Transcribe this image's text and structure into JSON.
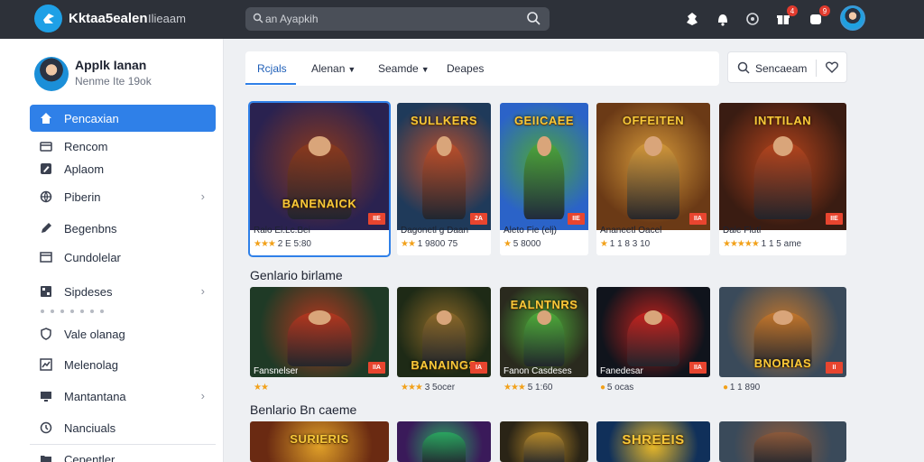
{
  "app": {
    "name": "Kktaa5ealen",
    "subtitle": "Ilieaam",
    "search_placeholder": "an Ayapkih",
    "brand_color": "#1ea0e6",
    "accent_color": "#2f80e8"
  },
  "topbar_icons": [
    {
      "icon": "puzzle-icon",
      "badge": ""
    },
    {
      "icon": "bell-icon",
      "badge": ""
    },
    {
      "icon": "circle-icon",
      "badge": ""
    },
    {
      "icon": "gift-icon",
      "badge": "4"
    },
    {
      "icon": "notification-icon",
      "badge": "9"
    }
  ],
  "profile": {
    "name": "Applk Ianan",
    "sub": "Nenme Ite 19ok"
  },
  "sidebar": {
    "items": [
      {
        "label": "Pencaxian",
        "icon": "home-icon",
        "chevron": false,
        "active": true
      },
      {
        "label": "Rencom",
        "icon": "card-icon",
        "chevron": false,
        "active": false
      },
      {
        "label": "Aplaom",
        "icon": "edit-icon",
        "chevron": false,
        "active": false
      },
      {
        "label": "Piberin",
        "icon": "globe-icon",
        "chevron": true,
        "active": false
      },
      {
        "label": "Begenbns",
        "icon": "pen-icon",
        "chevron": false,
        "active": false
      },
      {
        "label": "Cundolelar",
        "icon": "window-icon",
        "chevron": false,
        "active": false
      },
      {
        "label": "Sipdeses",
        "icon": "grid-icon",
        "chevron": true,
        "active": false
      },
      {
        "label": "Vale olanag",
        "icon": "shield-icon",
        "chevron": false,
        "active": false
      },
      {
        "label": "Melenolag",
        "icon": "chart-icon",
        "chevron": false,
        "active": false
      },
      {
        "label": "Mantantana",
        "icon": "monitor-icon",
        "chevron": true,
        "active": false
      },
      {
        "label": "Nanciuals",
        "icon": "clock-icon",
        "chevron": false,
        "active": false
      },
      {
        "label": "Cepentler",
        "icon": "folder-icon",
        "chevron": false,
        "active": false
      }
    ]
  },
  "tabs": [
    {
      "label": "Rcjals",
      "caret": false,
      "active": true
    },
    {
      "label": "Alenan",
      "caret": true,
      "active": false
    },
    {
      "label": "Seamde",
      "caret": true,
      "active": false
    },
    {
      "label": "Deapes",
      "caret": false,
      "active": false
    }
  ],
  "searchbox": {
    "label": "Sencaeam"
  },
  "featured": [
    {
      "art": "BANENAICK",
      "caption": "Ralo Ei.Lc.Bei",
      "meta": "2 E 5:80",
      "rating": 3,
      "tag": "IIE",
      "colors": [
        "#2a2250",
        "#8e3a1c"
      ]
    },
    {
      "art": "SULLKERS",
      "caption": "Dagonetl g Daan",
      "meta": "1 9800 75",
      "rating": 2,
      "tag": "2A",
      "colors": [
        "#1f3a5a",
        "#c0502a"
      ]
    },
    {
      "art": "GEIICAEE",
      "caption": "Aleto Fie (elj)",
      "meta": "5 8000",
      "rating": 1,
      "tag": "IIE",
      "colors": [
        "#2b63c8",
        "#4da63a"
      ]
    },
    {
      "art": "OFFEITEN",
      "caption": "Ananeetl Oacel",
      "meta": "1 1 8 3 10",
      "rating": 1,
      "tag": "IIA",
      "colors": [
        "#6b3a16",
        "#d79a3a"
      ]
    },
    {
      "art": "INTTILAN",
      "caption": "Dale Flutl",
      "meta": "1 1 5 ame",
      "rating": 5,
      "tag": "IIE",
      "colors": [
        "#3a1c12",
        "#b8451c"
      ]
    }
  ],
  "section1": {
    "title": "Genlario birlame",
    "items": [
      {
        "art": "",
        "caption": "Fansnelser",
        "meta": "",
        "rating": 0,
        "tag": "IIA",
        "colors": [
          "#1f3a26",
          "#b8371e"
        ]
      },
      {
        "art": "BANAINGS",
        "caption": "",
        "meta": "3 5ocer",
        "rating": 3,
        "tag": "IA",
        "colors": [
          "#1e2a16",
          "#8e6a28"
        ]
      },
      {
        "art": "EALNTNRS",
        "caption": "Fanon Casdeses",
        "meta": "5 1:60",
        "rating": 3,
        "tag": "",
        "colors": [
          "#2a2a1e",
          "#4fae3a"
        ]
      },
      {
        "art": "",
        "caption": "Fanedesar",
        "meta": "5 ocas",
        "rating": 1,
        "tag": "IIA",
        "colors": [
          "#10141c",
          "#c8231e"
        ]
      },
      {
        "art": "BNORIAS",
        "caption": "",
        "meta": "1 1 890",
        "rating": 1,
        "tag": "II",
        "colors": [
          "#3a4a5a",
          "#c8782a"
        ]
      }
    ]
  },
  "section2": {
    "title": "Benlario Bn caeme",
    "items": [
      {
        "art": "SURIERIS",
        "colors": [
          "#6a2a12",
          "#e0a028"
        ]
      },
      {
        "art": "",
        "colors": [
          "#3a1a5a",
          "#2aa860"
        ]
      },
      {
        "art": "",
        "colors": [
          "#2a2416",
          "#b88a2a"
        ]
      },
      {
        "art": "SHREEIS",
        "colors": [
          "#10305a",
          "#e8b828"
        ]
      },
      {
        "art": "",
        "colors": [
          "#3a4a5a",
          "#8e5a3a"
        ]
      }
    ]
  }
}
